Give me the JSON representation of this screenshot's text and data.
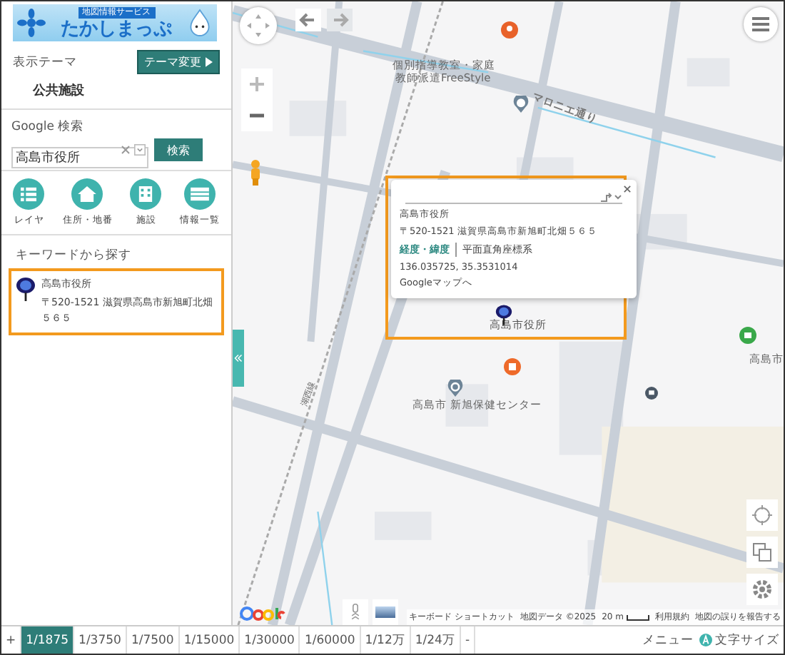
{
  "logo": {
    "subtitle": "地図情報サービス",
    "title": "たかしまっぷ"
  },
  "theme": {
    "label": "表示テーマ",
    "button": "テーマ変更",
    "value": "公共施設"
  },
  "search": {
    "label": "Google 検索",
    "value": "高島市役所",
    "button": "検索"
  },
  "tools": [
    {
      "kind": "list",
      "label": "レイヤ"
    },
    {
      "kind": "house",
      "label": "住所・地番"
    },
    {
      "kind": "building",
      "label": "施設"
    },
    {
      "kind": "table",
      "label": "情報一覧"
    }
  ],
  "keyword": {
    "heading": "キーワードから探す",
    "results": [
      {
        "name": "高島市役所",
        "address": "〒520-1521 滋賀県高島市新旭町北畑５６５",
        "selected": true
      }
    ]
  },
  "map_labels": [
    {
      "kind": "poi",
      "text": "個別指導教室・家庭"
    },
    {
      "kind": "poi",
      "text": "教師派遣FreeStyle"
    },
    {
      "kind": "road",
      "text": "マロニエ通り"
    },
    {
      "kind": "marker",
      "text": "高島市役所"
    },
    {
      "kind": "poi",
      "text": "高島市 新旭保健センター"
    },
    {
      "kind": "poi",
      "text": "高島市"
    },
    {
      "kind": "rail",
      "text": "湖西線"
    }
  ],
  "popup": {
    "name": "高島市役所",
    "address": "〒520-1521 滋賀県高島市新旭町北畑５６５",
    "tabs": [
      {
        "label": "経度・緯度",
        "selected": true
      },
      {
        "label": "平面直角座標系",
        "selected": false
      }
    ],
    "coords": "136.035725, 35.3531014",
    "link": "Googleマップへ"
  },
  "attribution": {
    "shortcuts": "キーボード ショートカット",
    "data": "地図データ ©2025",
    "scale": "20 m",
    "terms": "利用規約",
    "report": "地図の誤りを報告する"
  },
  "scales": [
    {
      "label": "1/1875",
      "selected": true
    },
    {
      "label": "1/3750",
      "selected": false
    },
    {
      "label": "1/7500",
      "selected": false
    },
    {
      "label": "1/15000",
      "selected": false
    },
    {
      "label": "1/30000",
      "selected": false
    },
    {
      "label": "1/60000",
      "selected": false
    },
    {
      "label": "1/12万",
      "selected": false
    },
    {
      "label": "1/24万",
      "selected": false
    }
  ],
  "footer": {
    "zoom_in": "+",
    "zoom_out": "-",
    "menu": "メニュー",
    "text_size": "文字サイズ"
  }
}
